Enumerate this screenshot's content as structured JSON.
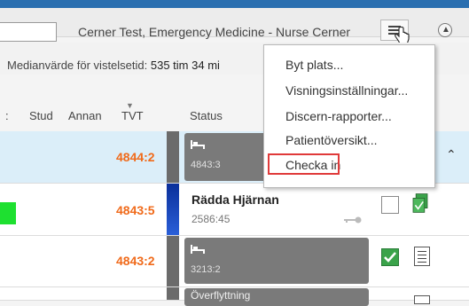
{
  "header": {
    "title": "Cerner Test, Emergency Medicine - Nurse Cerner",
    "search_value": ""
  },
  "summary": {
    "median_label": "Medianvärde för vistelsetid:",
    "median_value": "535 tim 34 mi"
  },
  "columns": {
    "stud": "Stud",
    "annan": "Annan",
    "tvt": "TVT",
    "status": "Status",
    "col_prefix": ":"
  },
  "rows": [
    {
      "tvt": "4844:2",
      "status_title": "",
      "status_sub": "4843:3"
    },
    {
      "tvt": "4843:5",
      "status_title": "Rädda Hjärnan",
      "status_sub": "2586:45"
    },
    {
      "tvt": "4843:2",
      "status_title": "",
      "status_sub": "3213:2"
    },
    {
      "tvt": "",
      "status_title": "Överflyttning",
      "status_sub": ""
    }
  ],
  "menu": {
    "items": [
      "Byt plats...",
      "Visningsinställningar...",
      "Discern-rapporter...",
      "Patientöversikt...",
      "Checka in"
    ],
    "highlighted": "Checka in"
  },
  "colors": {
    "accent": "#2a6fb0",
    "tvt": "#f06a1a",
    "highlight_border": "#e03a3a",
    "green_marker": "#1ee030"
  }
}
